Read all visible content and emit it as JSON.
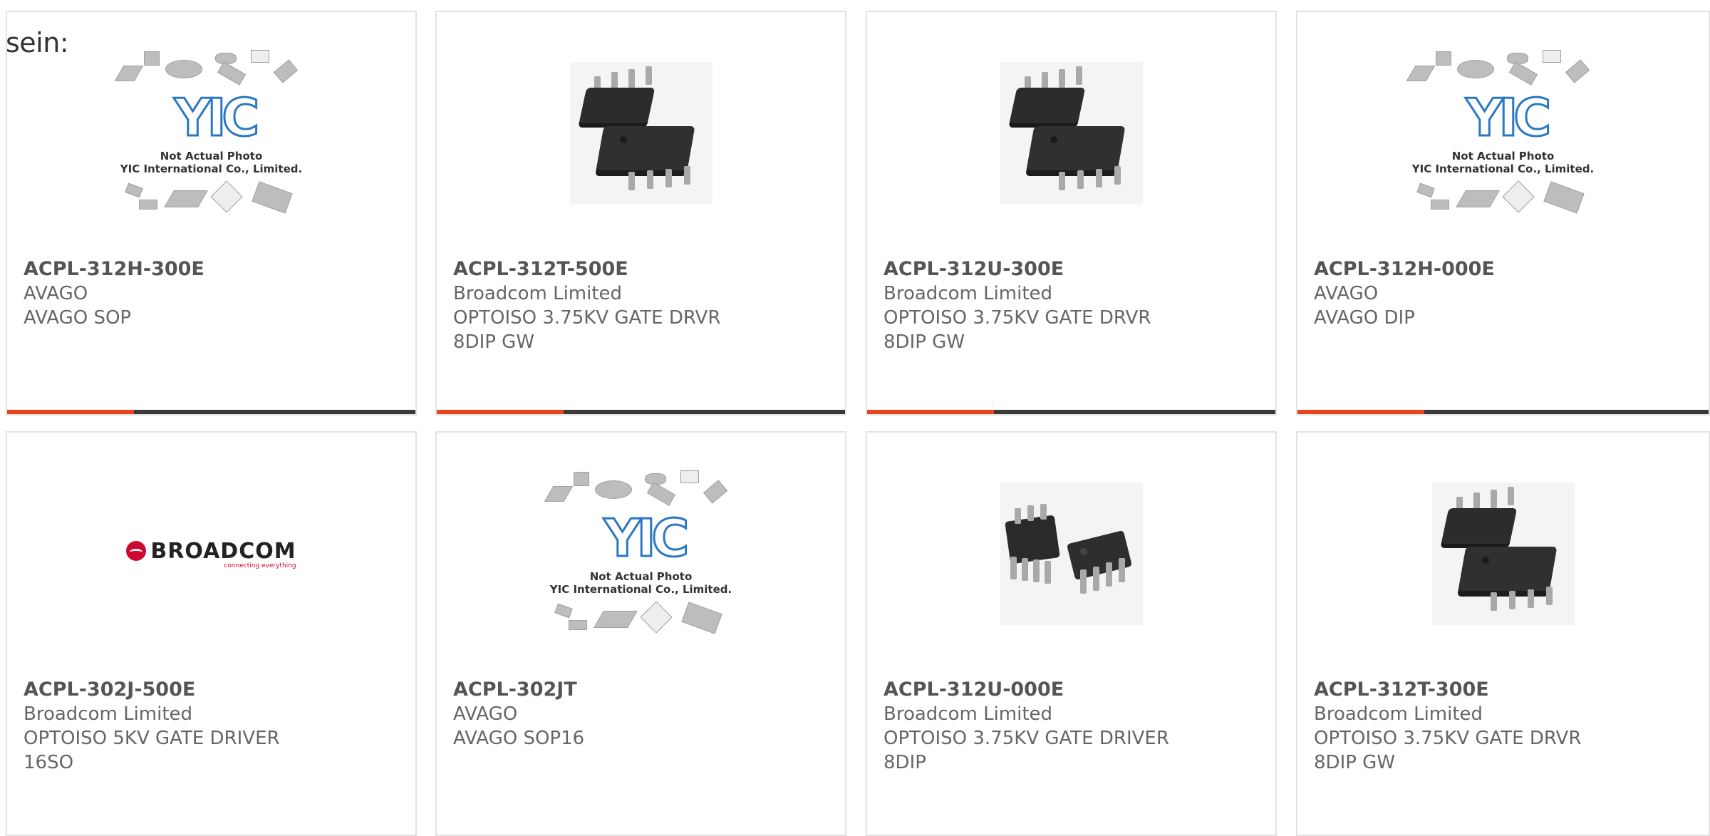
{
  "lead_text": "sein:",
  "placeholder": {
    "logo_text": "YIC",
    "line1": "Not Actual Photo",
    "line2": "YIC International Co., Limited."
  },
  "broadcom_logo": {
    "word": "BROADCOM",
    "tagline": "connecting everything"
  },
  "accent_colors": {
    "bar_accent": "#e8441d",
    "bar_base": "#3a3a3a",
    "broadcom_red": "#cc092f"
  },
  "products": [
    {
      "part": "ACPL-312H-300E",
      "maker": "AVAGO",
      "desc1": "AVAGO SOP",
      "desc2": "",
      "image": "placeholder",
      "progress": 0.31
    },
    {
      "part": "ACPL-312T-500E",
      "maker": "Broadcom Limited",
      "desc1": "OPTOISO 3.75KV GATE DRVR",
      "desc2": "8DIP GW",
      "image": "soic-package",
      "progress": 0.31
    },
    {
      "part": "ACPL-312U-300E",
      "maker": "Broadcom Limited",
      "desc1": "OPTOISO 3.75KV GATE DRVR",
      "desc2": "8DIP GW",
      "image": "soic-package",
      "progress": 0.31
    },
    {
      "part": "ACPL-312H-000E",
      "maker": "AVAGO",
      "desc1": "AVAGO DIP",
      "desc2": "",
      "image": "placeholder",
      "progress": 0.31
    },
    {
      "part": "ACPL-302J-500E",
      "maker": "Broadcom Limited",
      "desc1": "OPTOISO 5KV GATE DRIVER",
      "desc2": "16SO",
      "image": "broadcom-logo"
    },
    {
      "part": "ACPL-302JT",
      "maker": "AVAGO",
      "desc1": "AVAGO SOP16",
      "desc2": "",
      "image": "placeholder"
    },
    {
      "part": "ACPL-312U-000E",
      "maker": "Broadcom Limited",
      "desc1": "OPTOISO 3.75KV GATE DRIVER",
      "desc2": "8DIP",
      "image": "dip-package"
    },
    {
      "part": "ACPL-312T-300E",
      "maker": "Broadcom Limited",
      "desc1": "OPTOISO 3.75KV GATE DRVR",
      "desc2": "8DIP GW",
      "image": "soic-package"
    }
  ]
}
